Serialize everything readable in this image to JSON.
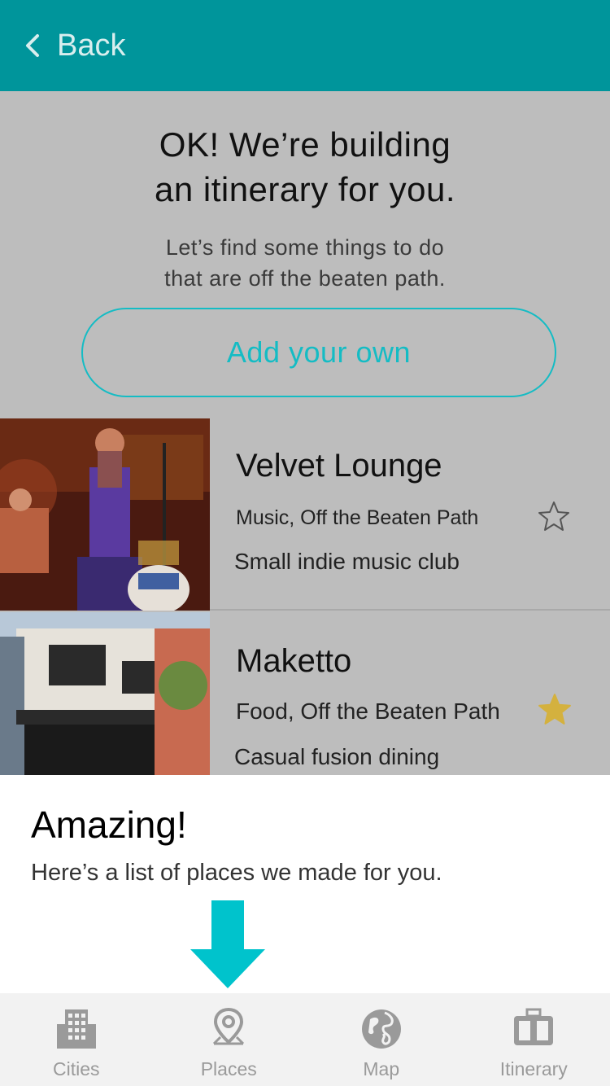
{
  "header": {
    "back_label": "Back",
    "back_icon": "chevron-left-icon",
    "color": "#00959b"
  },
  "intro": {
    "title_line1": "OK! We’re building",
    "title_line2": "an itinerary for you.",
    "subtitle_line1": "Let’s find some things to do",
    "subtitle_line2": "that are off the beaten path.",
    "add_button_label": "Add your own",
    "accent_color": "#14bcc4"
  },
  "places": [
    {
      "name": "Velvet Lounge",
      "categories": "Music, Off the Beaten Path",
      "description": "Small indie music club",
      "starred": false
    },
    {
      "name": "Maketto",
      "categories": "Food, Off the Beaten Path",
      "description": "Casual fusion dining",
      "starred": true,
      "star_color": "#d4b13e"
    }
  ],
  "overlay": {
    "title": "Amazing!",
    "subtitle": "Here’s a list of places we made for you.",
    "arrow_color": "#00c3cc"
  },
  "tabs": [
    {
      "label": "Cities",
      "icon": "buildings-icon"
    },
    {
      "label": "Places",
      "icon": "map-pin-icon"
    },
    {
      "label": "Map",
      "icon": "globe-icon"
    },
    {
      "label": "Itinerary",
      "icon": "suitcase-icon"
    }
  ]
}
